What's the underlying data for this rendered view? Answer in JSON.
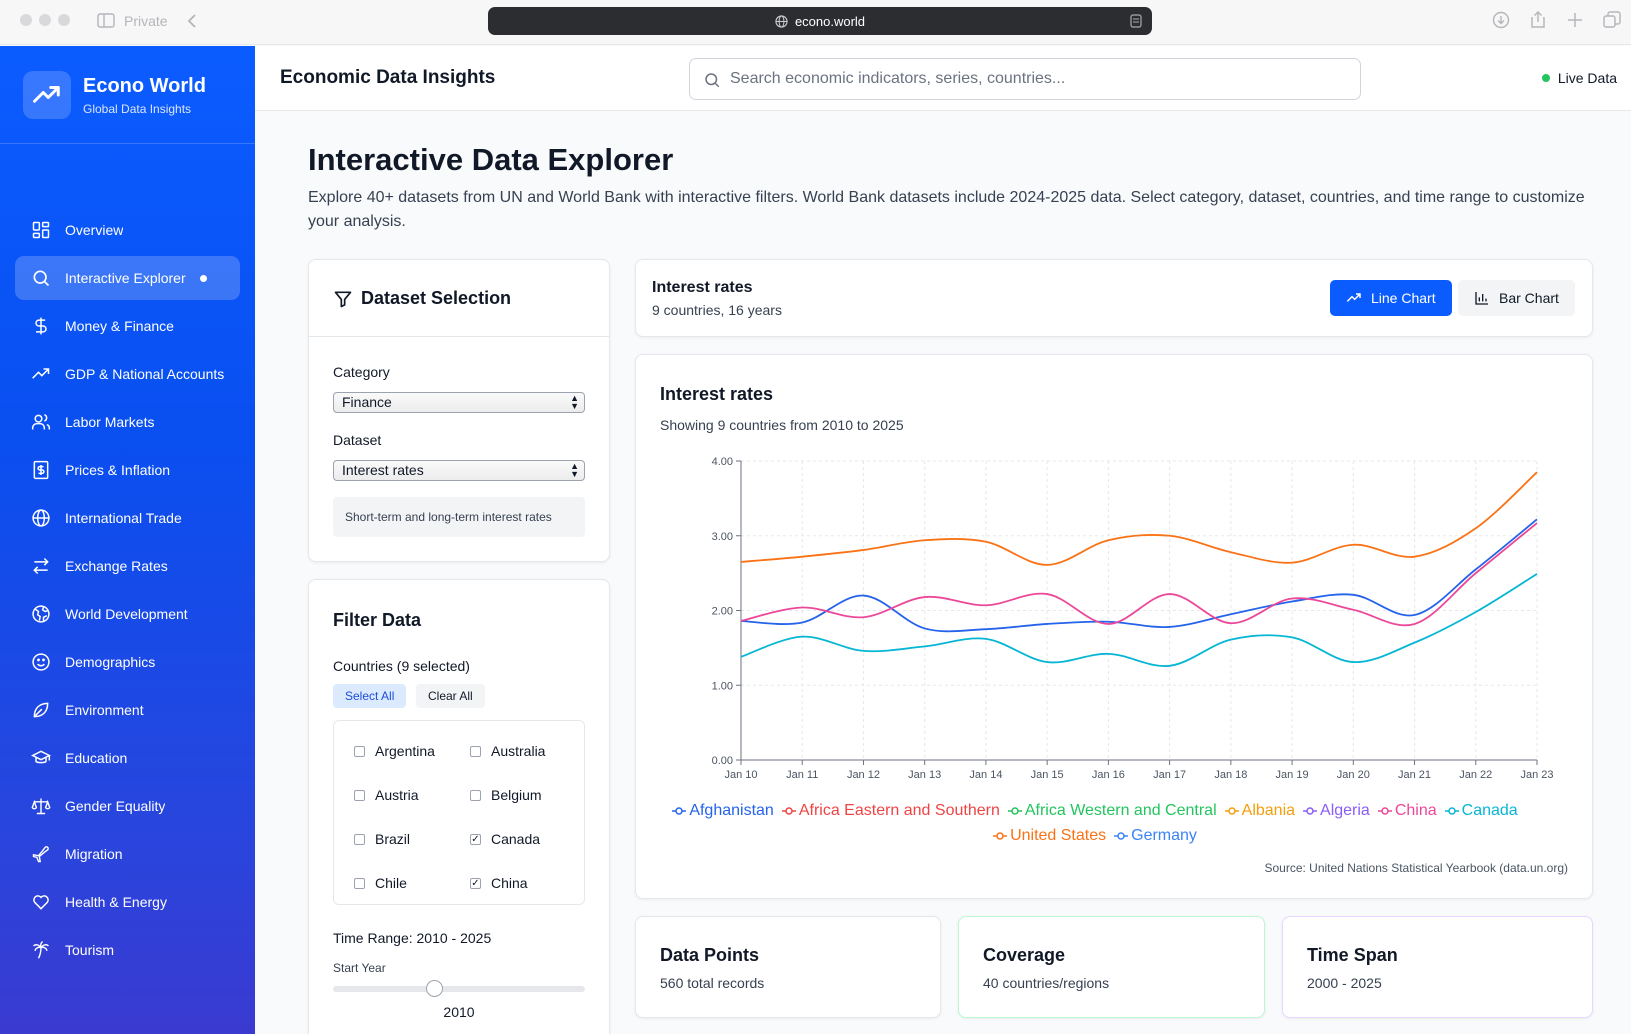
{
  "browser": {
    "private_label": "Private",
    "url": "econo.world"
  },
  "brand": {
    "name": "Econo World",
    "tagline": "Global Data Insights"
  },
  "sidebar": {
    "items": [
      {
        "label": "Overview",
        "icon": "grid-icon"
      },
      {
        "label": "Interactive Explorer",
        "icon": "search-icon",
        "active": true
      },
      {
        "label": "Money & Finance",
        "icon": "dollar-icon"
      },
      {
        "label": "GDP & National Accounts",
        "icon": "trending-up-icon"
      },
      {
        "label": "Labor Markets",
        "icon": "users-icon"
      },
      {
        "label": "Prices & Inflation",
        "icon": "receipt-dollar-icon"
      },
      {
        "label": "International Trade",
        "icon": "globe-icon"
      },
      {
        "label": "Exchange Rates",
        "icon": "arrows-exchange-icon"
      },
      {
        "label": "World Development",
        "icon": "world-icon"
      },
      {
        "label": "Demographics",
        "icon": "smile-icon"
      },
      {
        "label": "Environment",
        "icon": "leaf-icon"
      },
      {
        "label": "Education",
        "icon": "graduation-cap-icon"
      },
      {
        "label": "Gender Equality",
        "icon": "scale-icon"
      },
      {
        "label": "Migration",
        "icon": "plane-icon"
      },
      {
        "label": "Health & Energy",
        "icon": "heart-icon"
      },
      {
        "label": "Tourism",
        "icon": "palm-tree-icon"
      }
    ]
  },
  "header": {
    "title": "Economic Data Insights",
    "search_placeholder": "Search economic indicators, series, countries...",
    "status": "Live Data"
  },
  "main": {
    "title": "Interactive Data Explorer",
    "description": "Explore 40+ datasets from UN and World Bank with interactive filters. World Bank datasets include 2024-2025 data. Select category, dataset, countries, and time range to customize your analysis."
  },
  "dataset_selection": {
    "title": "Dataset Selection",
    "category_label": "Category",
    "category_value": "Finance",
    "dataset_label": "Dataset",
    "dataset_value": "Interest rates",
    "dataset_description": "Short-term and long-term interest rates"
  },
  "filter": {
    "title": "Filter Data",
    "countries_label": "Countries (9 selected)",
    "select_all": "Select All",
    "clear_all": "Clear All",
    "countries": [
      {
        "name": "Argentina",
        "checked": false
      },
      {
        "name": "Australia",
        "checked": false
      },
      {
        "name": "Austria",
        "checked": false
      },
      {
        "name": "Belgium",
        "checked": false
      },
      {
        "name": "Brazil",
        "checked": false
      },
      {
        "name": "Canada",
        "checked": true
      },
      {
        "name": "Chile",
        "checked": false
      },
      {
        "name": "China",
        "checked": true
      }
    ],
    "time_range_label": "Time Range: 2010 - 2025",
    "start_year_label": "Start Year",
    "start_year_value": "2010",
    "slider_fraction": 0.4
  },
  "chart_header": {
    "title": "Interest rates",
    "subtitle": "9 countries, 16 years",
    "line_chart_label": "Line Chart",
    "bar_chart_label": "Bar Chart"
  },
  "chart_card": {
    "title": "Interest rates",
    "subtitle": "Showing 9 countries from 2010 to 2025",
    "source": "Source: United Nations Statistical Yearbook (data.un.org)"
  },
  "chart_data": {
    "type": "line",
    "title": "Interest rates",
    "xlabel": "",
    "ylabel": "",
    "x": [
      "Jan 10",
      "Jan 11",
      "Jan 12",
      "Jan 13",
      "Jan 14",
      "Jan 15",
      "Jan 16",
      "Jan 17",
      "Jan 18",
      "Jan 19",
      "Jan 20",
      "Jan 21",
      "Jan 22",
      "Jan 23"
    ],
    "yticks": [
      "0.00",
      "1.00",
      "2.00",
      "3.00",
      "4.00"
    ],
    "ylim": [
      0,
      4
    ],
    "grid": true,
    "legend_position": "bottom",
    "series": [
      {
        "name": "Afghanistan",
        "color": "#2563eb",
        "values": [
          1.86,
          1.84,
          2.2,
          1.76,
          1.75,
          1.82,
          1.85,
          1.78,
          1.95,
          2.12,
          2.21,
          1.94,
          2.55,
          3.22
        ]
      },
      {
        "name": "Africa Eastern and Southern",
        "color": "#ef4444",
        "values": null
      },
      {
        "name": "Africa Western and Central",
        "color": "#22c55e",
        "values": null
      },
      {
        "name": "Albania",
        "color": "#f59e0b",
        "values": null
      },
      {
        "name": "Algeria",
        "color": "#8b5cf6",
        "values": null
      },
      {
        "name": "China",
        "color": "#ec4899",
        "values": [
          1.86,
          2.04,
          1.91,
          2.18,
          2.07,
          2.22,
          1.82,
          2.22,
          1.83,
          2.16,
          2.01,
          1.82,
          2.5,
          3.17
        ]
      },
      {
        "name": "Canada",
        "color": "#06b6d4",
        "values": [
          1.38,
          1.65,
          1.46,
          1.52,
          1.62,
          1.31,
          1.42,
          1.26,
          1.61,
          1.64,
          1.31,
          1.57,
          1.98,
          2.49
        ]
      },
      {
        "name": "United States",
        "color": "#f97316",
        "values": [
          2.65,
          2.72,
          2.81,
          2.94,
          2.92,
          2.61,
          2.94,
          3.0,
          2.78,
          2.64,
          2.88,
          2.72,
          3.1,
          3.85
        ]
      },
      {
        "name": "Germany",
        "color": "#3b82f6",
        "values": null
      }
    ]
  },
  "stats": [
    {
      "title": "Data Points",
      "value": "560 total records",
      "border": "#e5e7eb"
    },
    {
      "title": "Coverage",
      "value": "40 countries/regions",
      "border": "#bbf7d0"
    },
    {
      "title": "Time Span",
      "value": "2000 - 2025",
      "border": "#e9d5ff"
    }
  ]
}
